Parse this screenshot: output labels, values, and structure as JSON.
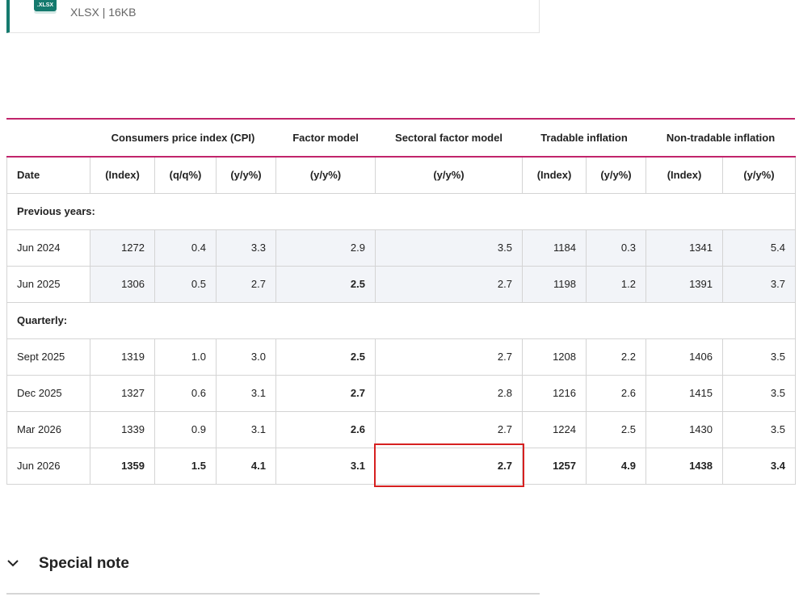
{
  "download": {
    "badge": ".XLSX",
    "meta": "XLSX | 16KB"
  },
  "table": {
    "groups": {
      "cpi": "Consumers price index (CPI)",
      "factor": "Factor model",
      "sectoral": "Sectoral factor model",
      "tradable": "Tradable inflation",
      "nontradable": "Non-tradable inflation"
    },
    "units": {
      "date": "Date",
      "cpi_index": "(Index)",
      "cpi_qq": "(q/q%)",
      "cpi_yy": "(y/y%)",
      "factor_yy": "(y/y%)",
      "sectoral_yy": "(y/y%)",
      "trad_index": "(Index)",
      "trad_yy": "(y/y%)",
      "nontrad_index": "(Index)",
      "nontrad_yy": "(y/y%)"
    },
    "sections": {
      "previous": "Previous years:",
      "quarterly": "Quarterly:"
    },
    "rows": {
      "jun2024": [
        "Jun 2024",
        "1272",
        "0.4",
        "3.3",
        "2.9",
        "3.5",
        "1184",
        "0.3",
        "1341",
        "5.4"
      ],
      "jun2025": [
        "Jun 2025",
        "1306",
        "0.5",
        "2.7",
        "2.5",
        "2.7",
        "1198",
        "1.2",
        "1391",
        "3.7"
      ],
      "sep2025": [
        "Sept 2025",
        "1319",
        "1.0",
        "3.0",
        "2.5",
        "2.7",
        "1208",
        "2.2",
        "1406",
        "3.5"
      ],
      "dec2025": [
        "Dec 2025",
        "1327",
        "0.6",
        "3.1",
        "2.7",
        "2.8",
        "1216",
        "2.6",
        "1415",
        "3.5"
      ],
      "mar2026": [
        "Mar 2026",
        "1339",
        "0.9",
        "3.1",
        "2.6",
        "2.7",
        "1224",
        "2.5",
        "1430",
        "3.5"
      ],
      "jun2026": [
        "Jun 2026",
        "1359",
        "1.5",
        "4.1",
        "3.1",
        "2.7",
        "1257",
        "4.9",
        "1438",
        "3.4"
      ]
    }
  },
  "special_note": {
    "title": "Special note"
  },
  "colors": {
    "accent": "#c1246b",
    "file_green": "#157a6e",
    "highlight_red": "#d62020",
    "shaded_bg": "#f2f4f8"
  }
}
